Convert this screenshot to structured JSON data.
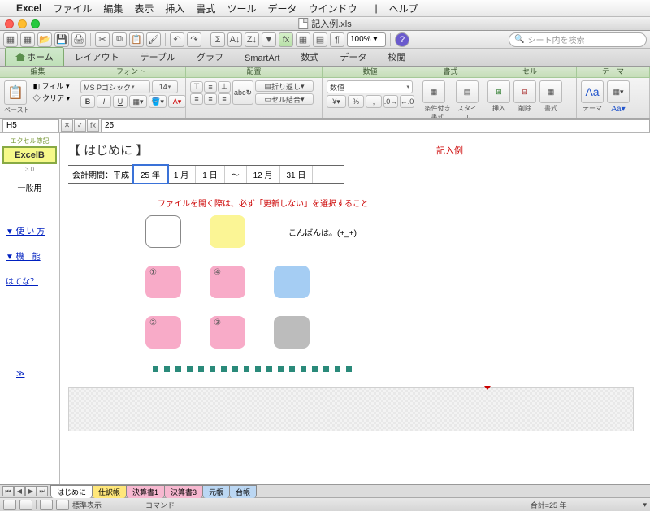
{
  "menubar": [
    "ファイル",
    "編集",
    "表示",
    "挿入",
    "書式",
    "ツール",
    "データ",
    "ウインドウ",
    "ヘルプ"
  ],
  "app_name": "Excel",
  "window_title": "記入例.xls",
  "zoom": "100%",
  "search_placeholder": "シート内を検索",
  "ribbon_tabs": [
    "ホーム",
    "レイアウト",
    "テーブル",
    "グラフ",
    "SmartArt",
    "数式",
    "データ",
    "校閲"
  ],
  "ribbon_groups": {
    "edit": "編集",
    "font": "フォント",
    "align": "配置",
    "number": "数値",
    "format": "書式",
    "cell": "セル",
    "theme": "テーマ"
  },
  "paste_label": "ペースト",
  "fill_label": "フィル",
  "clear_label": "クリア",
  "font_name": "MS Pゴシック",
  "font_size": "14",
  "wrap_label": "折り返し",
  "merge_label": "セル結合",
  "number_fmt": "数値",
  "condfmt": "条件付き書式",
  "styles": "スタイル",
  "insert": "挿入",
  "delete": "削除",
  "fmt": "書式",
  "theme": "テーマ",
  "cell_ref": "H5",
  "formula_val": "25",
  "sidebar": {
    "logo_sup": "エクセル簿記",
    "logo": "ExcelB",
    "ver": "3.0",
    "general": "一般用",
    "links": [
      "▼ 使 い 方",
      "▼ 機　能",
      "はてな？"
    ],
    "up": "≫"
  },
  "sheet": {
    "title": "【 はじめに 】",
    "example": "記入例",
    "period_label": "会計期間：平成",
    "period": [
      "25 年",
      "1 月",
      "1 日",
      "〜",
      "12 月",
      "31 日"
    ],
    "note": "ファイルを開く際は、必ず「更新しない」を選択すること",
    "greeting": "こんばんは。(+_+)",
    "nums": [
      "①",
      "④",
      "②",
      "③"
    ]
  },
  "sheet_tabs": [
    "はじめに",
    "仕訳帳",
    "決算書1",
    "決算書3",
    "元帳",
    "台帳"
  ],
  "status": {
    "view": "標準表示",
    "cmd": "コマンド",
    "sum": "合計=25 年"
  }
}
